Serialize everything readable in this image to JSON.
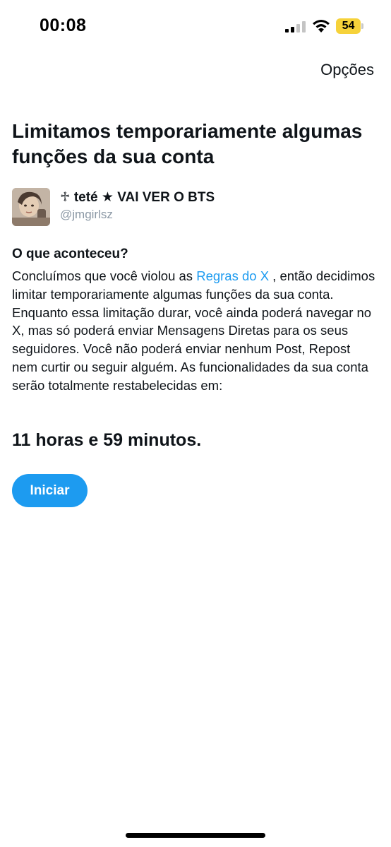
{
  "status_bar": {
    "time": "00:08",
    "battery_level": "54",
    "battery_color": "#f6d23a",
    "icons": [
      "cellular-signal-icon",
      "wifi-icon",
      "battery-icon"
    ]
  },
  "header": {
    "options_label": "Opções"
  },
  "headline": "Limitamos temporariamente algumas funções da sua conta",
  "account": {
    "display_name": "♱ teté ★ VAI VER O BTS",
    "handle": "@jmgirlsz"
  },
  "what_happened": {
    "title": "O que aconteceu?",
    "text_before_link": "Concluímos que você violou as ",
    "link_label": "Regras do X",
    "text_after_link": " , então decidimos limitar temporariamente algumas funções da sua conta. Enquanto essa limitação durar, você ainda poderá navegar no X, mas só poderá enviar Mensagens Diretas para os seus seguidores. Você não poderá enviar nenhum Post, Repost nem curtir ou seguir alguém. As funcionalidades da sua conta serão totalmente restabelecidas em:"
  },
  "countdown": "11 horas e 59 minutos.",
  "start_button_label": "Iniciar",
  "colors": {
    "accent": "#1d9bf0",
    "text": "#0f1419",
    "secondary_text": "#8b98a5"
  }
}
